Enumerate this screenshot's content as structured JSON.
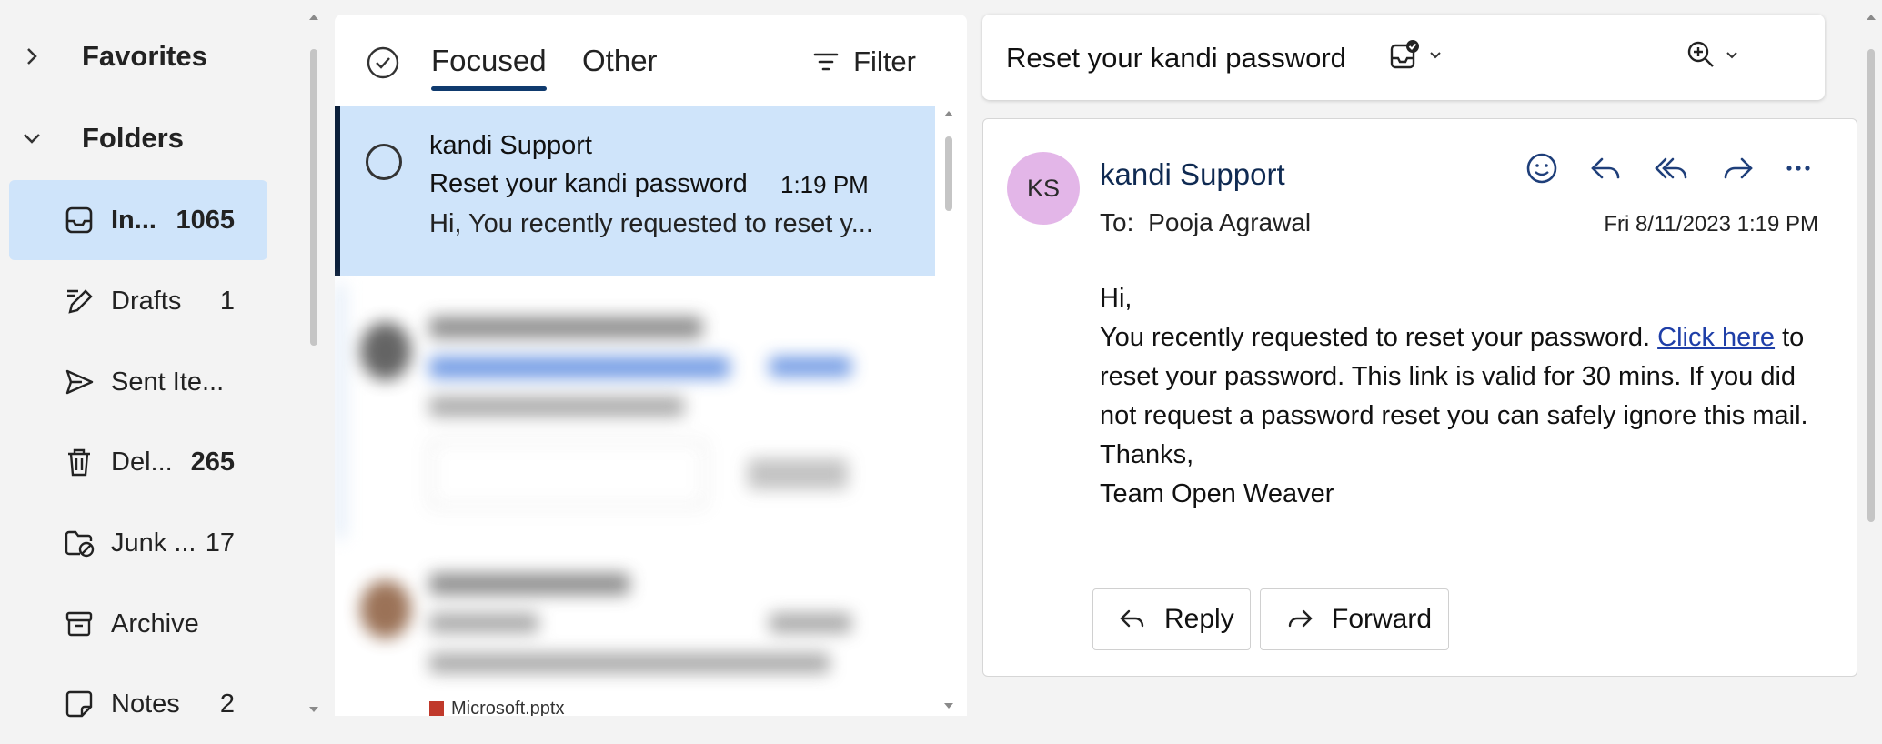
{
  "folders": {
    "favorites_label": "Favorites",
    "folders_label": "Folders",
    "items": [
      {
        "label": "In...",
        "count": "1065",
        "icon": "inbox-icon"
      },
      {
        "label": "Drafts",
        "count": "1",
        "icon": "drafts-icon"
      },
      {
        "label": "Sent Ite...",
        "count": "",
        "icon": "sent-icon"
      },
      {
        "label": "Del...",
        "count": "265",
        "icon": "trash-icon"
      },
      {
        "label": "Junk ...",
        "count": "17",
        "icon": "junk-icon"
      },
      {
        "label": "Archive",
        "count": "",
        "icon": "archive-icon"
      },
      {
        "label": "Notes",
        "count": "2",
        "icon": "notes-icon"
      }
    ]
  },
  "message_list": {
    "tabs": [
      "Focused",
      "Other"
    ],
    "active_tab": "Focused",
    "filter_label": "Filter",
    "selected_message": {
      "sender": "kandi Support",
      "subject": "Reset your kandi password",
      "time": "1:19 PM",
      "preview": "Hi, You recently requested to reset y..."
    },
    "partial_attachment_label": "Microsoft.pptx"
  },
  "reading_pane": {
    "subject": "Reset your kandi password",
    "avatar_initials": "KS",
    "from": "kandi Support",
    "to_label": "To:",
    "to_name": "Pooja Agrawal",
    "date": "Fri 8/11/2023 1:19 PM",
    "body": {
      "greeting": "Hi,",
      "line1_pre": "You recently requested to reset your password.",
      "link_text": "Click here",
      "line1_post": "to reset your password. This link is valid for 30 mins. If you did not request a password reset you can safely ignore this mail.",
      "signoff": "Thanks,",
      "signature": "Team Open Weaver"
    },
    "reply_label": "Reply",
    "forward_label": "Forward"
  },
  "colors": {
    "selection": "#cfe4fa",
    "accent": "#0f3a6e",
    "avatar_bg": "#e3b6e8",
    "link": "#1f3fa8"
  }
}
